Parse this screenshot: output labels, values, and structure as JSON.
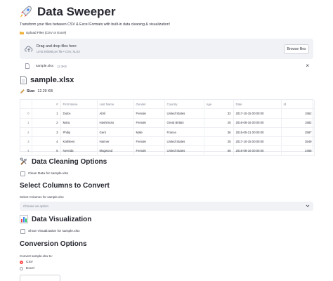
{
  "header": {
    "title": "Data Sweeper",
    "icon": "rocket-icon"
  },
  "subtitle": "Transform your files between CSV & Excel Formats with built-in data cleaning & visualization!",
  "uploader": {
    "label": "Upload Files (CSV or Excel)",
    "drop_text": "Drag and drop files here",
    "hint": "Limit 200MB per file • CSV, XLSX",
    "browse_label": "Browse files",
    "file_name": "sample.xlsx",
    "file_size": "12.3KB"
  },
  "file_section": {
    "title": "sample.xlsx",
    "size_label": "Size:",
    "size_value": "12.29 KB"
  },
  "table": {
    "columns": [
      "",
      "#",
      "First Name",
      "Last Name",
      "Gender",
      "Country",
      "Age",
      "Date",
      "Id"
    ],
    "rows": [
      [
        "0",
        "1",
        "Dulce",
        "Abril",
        "Female",
        "United States",
        "32",
        "2017-10-15 00:00:00",
        "1562"
      ],
      [
        "1",
        "2",
        "Mara",
        "Hashimoto",
        "Female",
        "Great Britain",
        "25",
        "2016-08-16 00:00:00",
        "1582"
      ],
      [
        "2",
        "3",
        "Philip",
        "Gent",
        "Male",
        "France",
        "36",
        "2015-05-21 00:00:00",
        "2587"
      ],
      [
        "3",
        "4",
        "Kathleen",
        "Hanner",
        "Female",
        "United States",
        "25",
        "2017-10-15 00:00:00",
        "3549"
      ],
      [
        "4",
        "5",
        "Nereida",
        "Magwood",
        "Female",
        "United States",
        "58",
        "2016-08-16 00:00:00",
        "2468"
      ]
    ]
  },
  "cleaning": {
    "title": "Data Cleaning Options",
    "checkbox_label": "Clean Data for sample.xlsx"
  },
  "columns_select": {
    "title": "Select Columns to Convert",
    "label": "Select Columns for sample.xlsx",
    "placeholder": "Choose an option"
  },
  "visualization": {
    "title": "Data Visualization",
    "checkbox_label": "Show Visualization for sample.xlsx"
  },
  "conversion": {
    "title": "Conversion Options",
    "label": "Convert sample.xlsx to:",
    "options": [
      "CSV",
      "Excel"
    ],
    "selected": "CSV"
  },
  "colors": {
    "accent": "#ff4b4b",
    "panel": "#f0f2f6",
    "text": "#31333f"
  }
}
